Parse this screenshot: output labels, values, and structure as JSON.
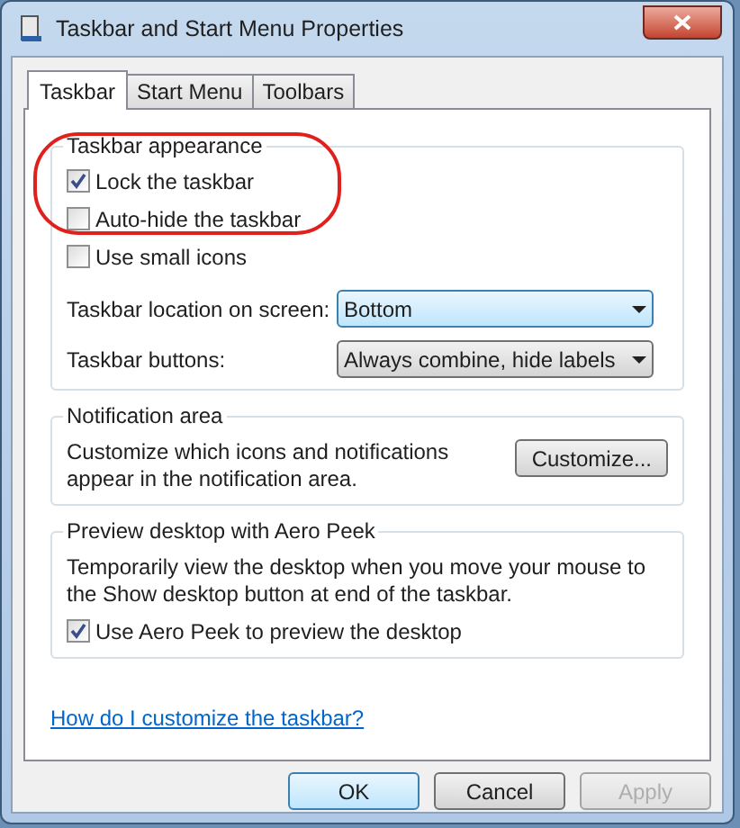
{
  "window": {
    "title": "Taskbar and Start Menu Properties"
  },
  "tabs": [
    {
      "label": "Taskbar",
      "selected": true
    },
    {
      "label": "Start Menu",
      "selected": false
    },
    {
      "label": "Toolbars",
      "selected": false
    }
  ],
  "appearance": {
    "title": "Taskbar appearance",
    "checkboxes": [
      {
        "label": "Lock the taskbar",
        "checked": true
      },
      {
        "label": "Auto-hide the taskbar",
        "checked": false
      },
      {
        "label": "Use small icons",
        "checked": false
      }
    ],
    "dropdowns": [
      {
        "label": "Taskbar location on screen:",
        "value": "Bottom",
        "focused": true
      },
      {
        "label": "Taskbar buttons:",
        "value": "Always combine, hide labels",
        "focused": false
      }
    ]
  },
  "notification_area": {
    "title": "Notification area",
    "text": "Customize which icons and notifications appear in the notification area.",
    "button": "Customize..."
  },
  "aero_peek": {
    "title": "Preview desktop with Aero Peek",
    "text": "Temporarily view the desktop when you move your mouse to the Show desktop button at end of the taskbar.",
    "checkbox": {
      "label": "Use Aero Peek to preview the desktop",
      "checked": true
    }
  },
  "help_link": "How do I customize the taskbar?",
  "buttons": [
    {
      "label": "OK",
      "default": true,
      "disabled": false
    },
    {
      "label": "Cancel",
      "default": false,
      "disabled": false
    },
    {
      "label": "Apply",
      "default": false,
      "disabled": true
    }
  ]
}
